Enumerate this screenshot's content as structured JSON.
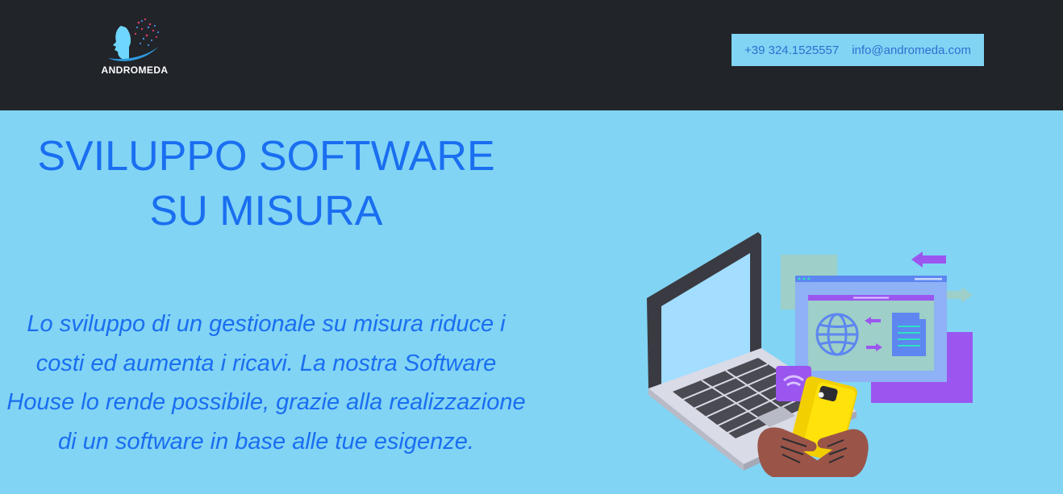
{
  "header": {
    "logo_text": "ANDROMEDA",
    "phone": "+39 324.1525557",
    "email": "info@andromeda.com"
  },
  "hero": {
    "title_line1": "SVILUPPO SOFTWARE",
    "title_line2": "SU MISURA",
    "description": "Lo sviluppo di un gestionale su misura riduce i costi ed aumenta i ricavi. La nostra Software House lo rende possibile, grazie alla realizzazione di un software in base alle tue esigenze."
  },
  "colors": {
    "header_bg": "#212429",
    "page_bg": "#81d4f4",
    "accent_text": "#1a6ef0"
  },
  "icons": [
    "andromeda-logo",
    "laptop-illustration",
    "phone-illustration",
    "globe-icon",
    "document-icon",
    "arrow-icon"
  ]
}
